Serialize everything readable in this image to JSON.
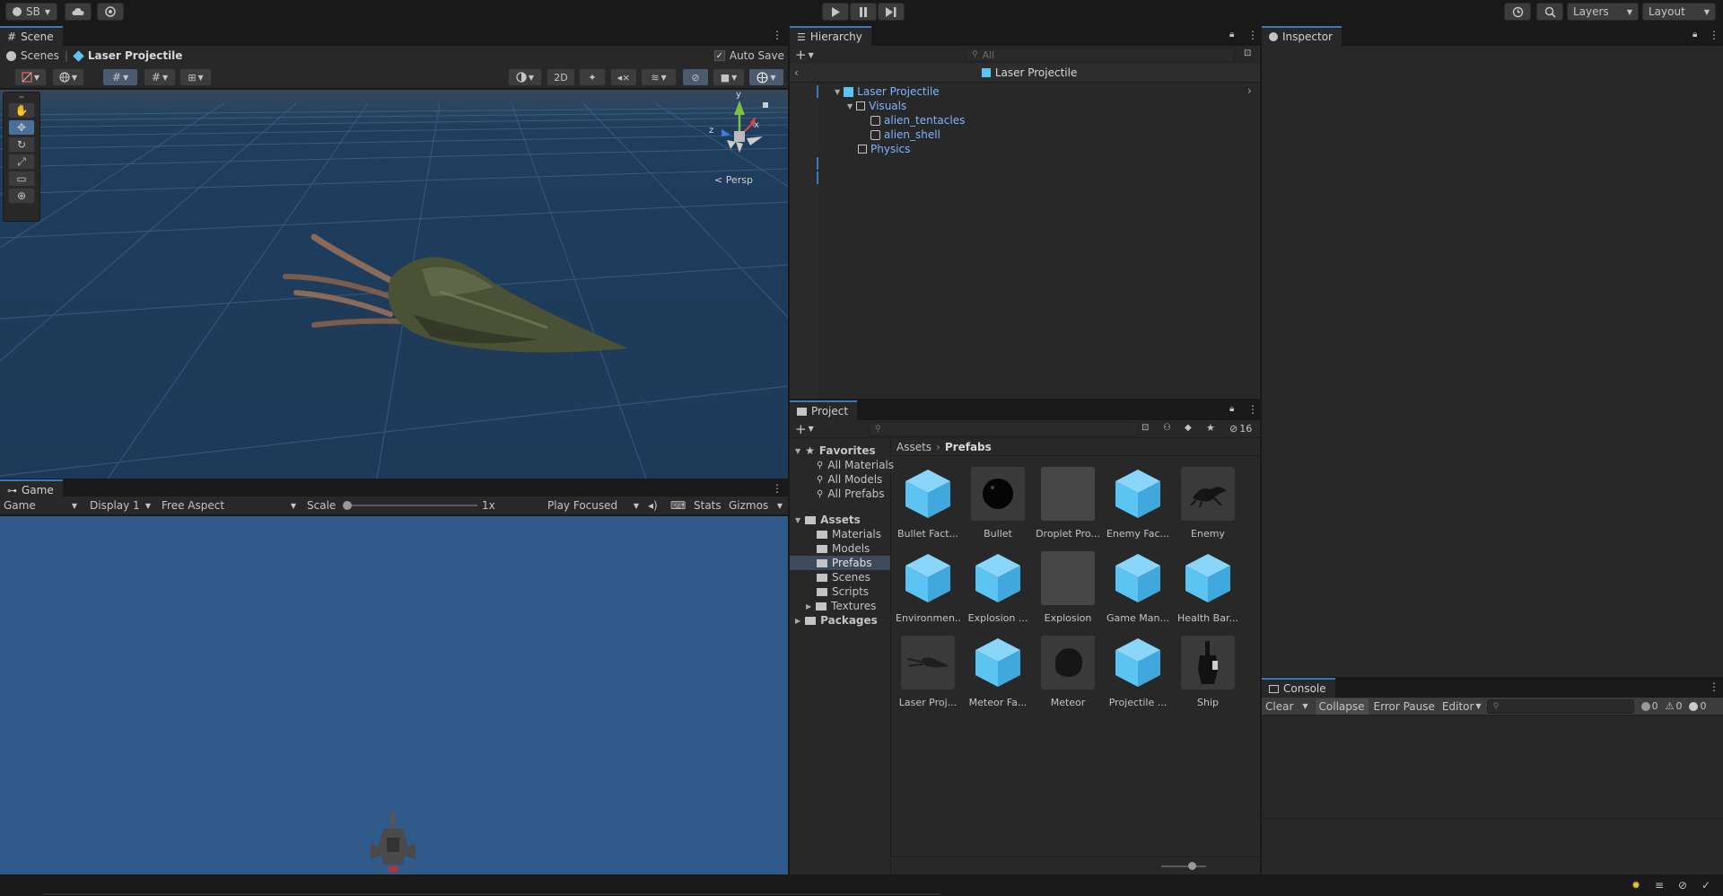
{
  "topbar": {
    "account": "SB",
    "layers": "Layers",
    "layout": "Layout"
  },
  "scene": {
    "tab": "Scene",
    "breadcrumb_root": "Scenes",
    "breadcrumb_current": "Laser Projectile",
    "auto_save": "Auto Save",
    "btn_2d": "2D",
    "persp": "< Persp",
    "gizmo_y": "y",
    "gizmo_z": "z",
    "gizmo_x": "x"
  },
  "game": {
    "tab": "Game",
    "mode": "Game",
    "display": "Display 1",
    "aspect": "Free Aspect",
    "scale_label": "Scale",
    "scale_value": "1x",
    "play_focused": "Play Focused",
    "stats": "Stats",
    "gizmos": "Gizmos"
  },
  "hierarchy": {
    "tab": "Hierarchy",
    "search_placeholder": "All",
    "header": "Laser Projectile",
    "items": [
      {
        "label": "Laser Projectile"
      },
      {
        "label": "Visuals"
      },
      {
        "label": "alien_tentacles"
      },
      {
        "label": "alien_shell"
      },
      {
        "label": "Physics"
      }
    ]
  },
  "inspector": {
    "tab": "Inspector"
  },
  "project": {
    "tab": "Project",
    "badge": "16",
    "breadcrumb_root": "Assets",
    "breadcrumb_current": "Prefabs",
    "favorites": "Favorites",
    "favorite_items": [
      "All Materials",
      "All Models",
      "All Prefabs"
    ],
    "assets_label": "Assets",
    "asset_folders": [
      "Materials",
      "Models",
      "Prefabs",
      "Scenes",
      "Scripts",
      "Textures"
    ],
    "packages": "Packages",
    "assets": [
      {
        "label": "Bullet Fact...",
        "thumb": "cube"
      },
      {
        "label": "Bullet",
        "thumb": "sphere"
      },
      {
        "label": "Droplet Pro...",
        "thumb": "blank"
      },
      {
        "label": "Enemy Fac...",
        "thumb": "cube"
      },
      {
        "label": "Enemy",
        "thumb": "creature"
      },
      {
        "label": "Environmen...",
        "thumb": "cube"
      },
      {
        "label": "Explosion ...",
        "thumb": "cube"
      },
      {
        "label": "Explosion",
        "thumb": "blank"
      },
      {
        "label": "Game Man...",
        "thumb": "cube"
      },
      {
        "label": "Health Bar...",
        "thumb": "cube"
      },
      {
        "label": "Laser Proj...",
        "thumb": "squid"
      },
      {
        "label": "Meteor Fa...",
        "thumb": "cube"
      },
      {
        "label": "Meteor",
        "thumb": "rock"
      },
      {
        "label": "Projectile ...",
        "thumb": "cube"
      },
      {
        "label": "Ship",
        "thumb": "ship"
      }
    ]
  },
  "console": {
    "tab": "Console",
    "clear": "Clear",
    "collapse": "Collapse",
    "error_pause": "Error Pause",
    "editor": "Editor",
    "count_info": "0",
    "count_warn": "0",
    "count_error": "0"
  },
  "colors": {
    "accent": "#3a79bb",
    "scene_bg": "#1e3c5a",
    "game_bg": "#2f5a8a",
    "prefab_blue": "#7db5ff",
    "cube": "#5cc4f2"
  }
}
